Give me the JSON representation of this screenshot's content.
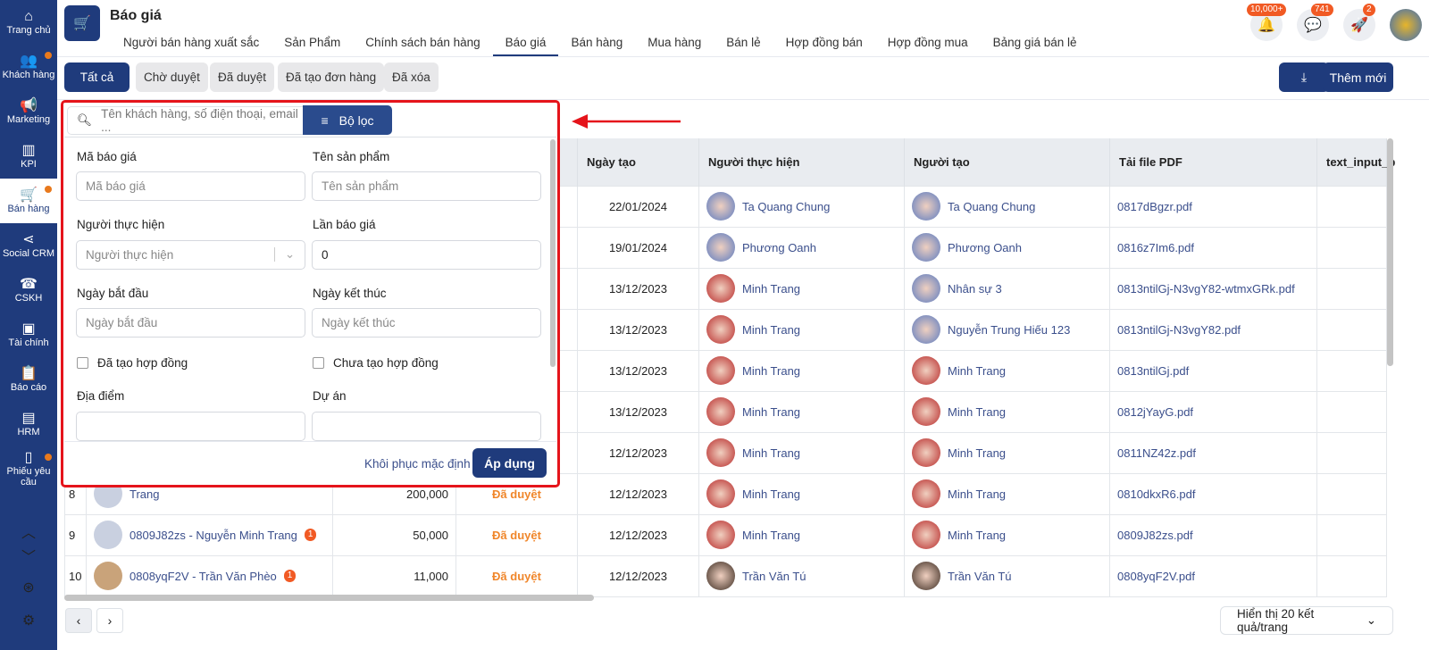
{
  "sidebar": {
    "items": [
      {
        "label": "Trang chủ",
        "icon": "home-icon",
        "glyph": "⌂",
        "dot": false
      },
      {
        "label": "Khách hàng",
        "icon": "users-icon",
        "glyph": "👥",
        "dot": true
      },
      {
        "label": "Marketing",
        "icon": "megaphone-icon",
        "glyph": "📢",
        "dot": false
      },
      {
        "label": "KPI",
        "icon": "chart-icon",
        "glyph": "▥",
        "dot": false
      },
      {
        "label": "Bán hàng",
        "icon": "cart-icon",
        "glyph": "🛒",
        "dot": true,
        "active": true
      },
      {
        "label": "Social CRM",
        "icon": "share-icon",
        "glyph": "⋖",
        "dot": false
      },
      {
        "label": "CSKH",
        "icon": "phone-icon",
        "glyph": "☎",
        "dot": false
      },
      {
        "label": "Tài chính",
        "icon": "wallet-icon",
        "glyph": "▣",
        "dot": false
      },
      {
        "label": "Báo cáo",
        "icon": "clipboard-icon",
        "glyph": "📋",
        "dot": false
      },
      {
        "label": "HRM",
        "icon": "id-card-icon",
        "glyph": "▤",
        "dot": false
      },
      {
        "label": "Phiếu yêu cầu",
        "icon": "document-icon",
        "glyph": "▯",
        "dot": true
      }
    ]
  },
  "header": {
    "title": "Báo giá",
    "tabs": [
      "Người bán hàng xuất sắc",
      "Sản Phẩm",
      "Chính sách bán hàng",
      "Báo giá",
      "Bán hàng",
      "Mua hàng",
      "Bán lẻ",
      "Hợp đồng bán",
      "Hợp đồng mua",
      "Bảng giá bán lẻ"
    ],
    "active_tab": "Báo giá",
    "notifications": "10,000+",
    "messages": "741",
    "rocket": "2"
  },
  "filters": {
    "buttons": [
      "Tất cả",
      "Chờ duyệt",
      "Đã duyệt",
      "Đã tạo đơn hàng",
      "Đã xóa"
    ],
    "active": "Tất cả",
    "add_label": "Thêm mới"
  },
  "popup": {
    "search_placeholder": "Tên khách hàng, số điện thoại, email ...",
    "filter_label": "Bộ lọc",
    "fields": {
      "quote_code_label": "Mã báo giá",
      "quote_code_ph": "Mã báo giá",
      "product_label": "Tên sản phẩm",
      "product_ph": "Tên sản phẩm",
      "performer_label": "Người thực hiện",
      "performer_ph": "Người thực hiện",
      "times_label": "Lần báo giá",
      "times_value": "0",
      "start_label": "Ngày bắt đầu",
      "start_ph": "Ngày bắt đầu",
      "end_label": "Ngày kết thúc",
      "end_ph": "Ngày kết thúc",
      "has_contract": "Đã tạo hợp đồng",
      "no_contract": "Chưa tạo hợp đồng",
      "location_label": "Địa điểm",
      "project_label": "Dự án"
    },
    "reset_label": "Khôi phục mặc định",
    "apply_label": "Áp dụng"
  },
  "table": {
    "headers": [
      "",
      "",
      "",
      "",
      "Ngày tạo",
      "Người thực hiện",
      "Người tạo",
      "Tải file PDF",
      "text_input_b"
    ],
    "rows": [
      {
        "no": "",
        "customer": "",
        "count": "",
        "amount": "",
        "status": "",
        "date": "22/01/2024",
        "performer": "Ta Quang Chung",
        "creator": "Ta Quang Chung",
        "pdf": "0817dBgzr.pdf"
      },
      {
        "no": "",
        "customer": "",
        "count": "",
        "amount": "",
        "status": "",
        "date": "19/01/2024",
        "performer": "Phương Oanh",
        "creator": "Phương Oanh",
        "pdf": "0816z7Im6.pdf"
      },
      {
        "no": "",
        "customer": "",
        "count": "",
        "amount": "",
        "status": "",
        "date": "13/12/2023",
        "performer": "Minh Trang",
        "creator": "Nhân sự 3",
        "pdf": "0813ntilGj-N3vgY82-wtmxGRk.pdf"
      },
      {
        "no": "",
        "customer": "",
        "count": "",
        "amount": "",
        "status": "",
        "date": "13/12/2023",
        "performer": "Minh Trang",
        "creator": "Nguyễn Trung Hiếu 123",
        "pdf": "0813ntilGj-N3vgY82.pdf"
      },
      {
        "no": "",
        "customer": "",
        "count": "",
        "amount": "",
        "status": "",
        "date": "13/12/2023",
        "performer": "Minh Trang",
        "creator": "Minh Trang",
        "pdf": "0813ntilGj.pdf"
      },
      {
        "no": "",
        "customer": "",
        "count": "",
        "amount": "",
        "status": "",
        "date": "13/12/2023",
        "performer": "Minh Trang",
        "creator": "Minh Trang",
        "pdf": "0812jYayG.pdf"
      },
      {
        "no": "",
        "customer": "",
        "count": "",
        "amount": "",
        "status": "",
        "date": "12/12/2023",
        "performer": "Minh Trang",
        "creator": "Minh Trang",
        "pdf": "0811NZ42z.pdf"
      },
      {
        "no": "8",
        "customer": "Trang",
        "count": "",
        "amount": "200,000",
        "status": "Đã duyệt",
        "date": "12/12/2023",
        "performer": "Minh Trang",
        "creator": "Minh Trang",
        "pdf": "0810dkxR6.pdf"
      },
      {
        "no": "9",
        "customer": "0809J82zs - Nguyễn Minh Trang",
        "count": "1",
        "amount": "50,000",
        "status": "Đã duyệt",
        "date": "12/12/2023",
        "performer": "Minh Trang",
        "creator": "Minh Trang",
        "pdf": "0809J82zs.pdf"
      },
      {
        "no": "10",
        "customer": "0808yqF2V - Trần Văn Phèo",
        "count": "1",
        "amount": "11,000",
        "status": "Đã duyệt",
        "date": "12/12/2023",
        "performer": "Trần Văn Tú",
        "creator": "Trần Văn Tú",
        "pdf": "0808yqF2V.pdf"
      }
    ]
  },
  "pagination": {
    "page_size_label": "Hiển thị 20 kết quả/trang"
  },
  "colors": {
    "primary": "#1f3b7c",
    "status": "#f0862a",
    "badge": "#f15a24",
    "highlight": "#e5141b"
  }
}
